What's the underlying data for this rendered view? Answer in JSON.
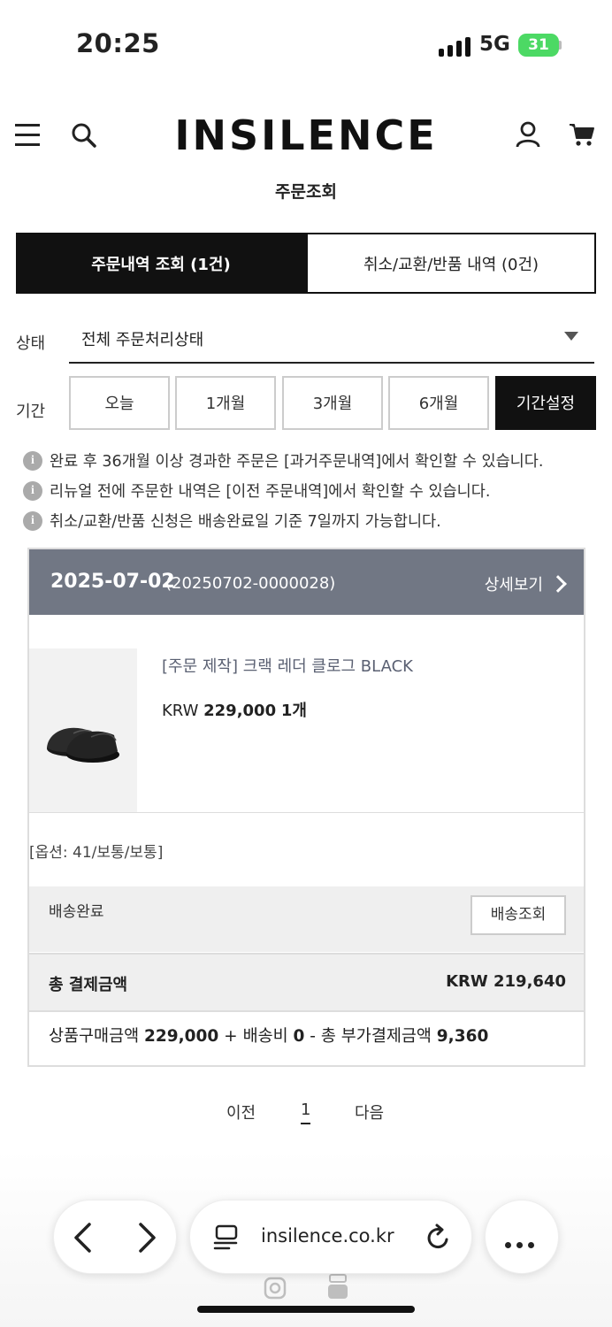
{
  "status_bar": {
    "time": "20:25",
    "network": "5G",
    "battery": "31"
  },
  "header": {
    "brand": "INSILENCE",
    "page_title": "주문조회"
  },
  "tabs": [
    {
      "label": "주문내역 조회 (1건)",
      "active": true
    },
    {
      "label": "취소/교환/반품 내역 (0건)",
      "active": false
    }
  ],
  "filters": {
    "status_label": "상태",
    "status_value": "전체 주문처리상태",
    "period_label": "기간",
    "periods": [
      {
        "label": "오늘",
        "active": false
      },
      {
        "label": "1개월",
        "active": false
      },
      {
        "label": "3개월",
        "active": false
      },
      {
        "label": "6개월",
        "active": false
      },
      {
        "label": "기간설정",
        "active": true
      }
    ]
  },
  "notices": [
    "완료 후 36개월 이상 경과한 주문은 [과거주문내역]에서 확인할 수 있습니다.",
    "리뉴얼 전에 주문한 내역은 [이전 주문내역]에서 확인할 수 있습니다.",
    "취소/교환/반품 신청은 배송완료일 기준 7일까지 가능합니다."
  ],
  "order": {
    "date": "2025-07-02",
    "number": "(20250702-0000028)",
    "detail_label": "상세보기",
    "product_name": "[주문 제작] 크랙 레더 클로그 BLACK",
    "currency": "KRW",
    "price": "229,000",
    "quantity": "1개",
    "option": "[옵션: 41/보통/보통]",
    "shipping_status": "배송완료",
    "track_label": "배송조회",
    "total_label": "총 결제금액",
    "total_value": "KRW 219,640",
    "breakdown": {
      "goods_label": "상품구매금액",
      "goods_value": "229,000",
      "plus": "+",
      "ship_label": "배송비",
      "ship_value": "0",
      "minus": "-",
      "extra_label": "총 부가결제금액",
      "extra_value": "9,360"
    }
  },
  "pagination": {
    "prev": "이전",
    "current": "1",
    "next": "다음"
  },
  "browser": {
    "url": "insilence.co.kr"
  },
  "colors": {
    "order_header_bg": "#717784",
    "active_tab": "#111111",
    "battery": "#4cd964"
  }
}
